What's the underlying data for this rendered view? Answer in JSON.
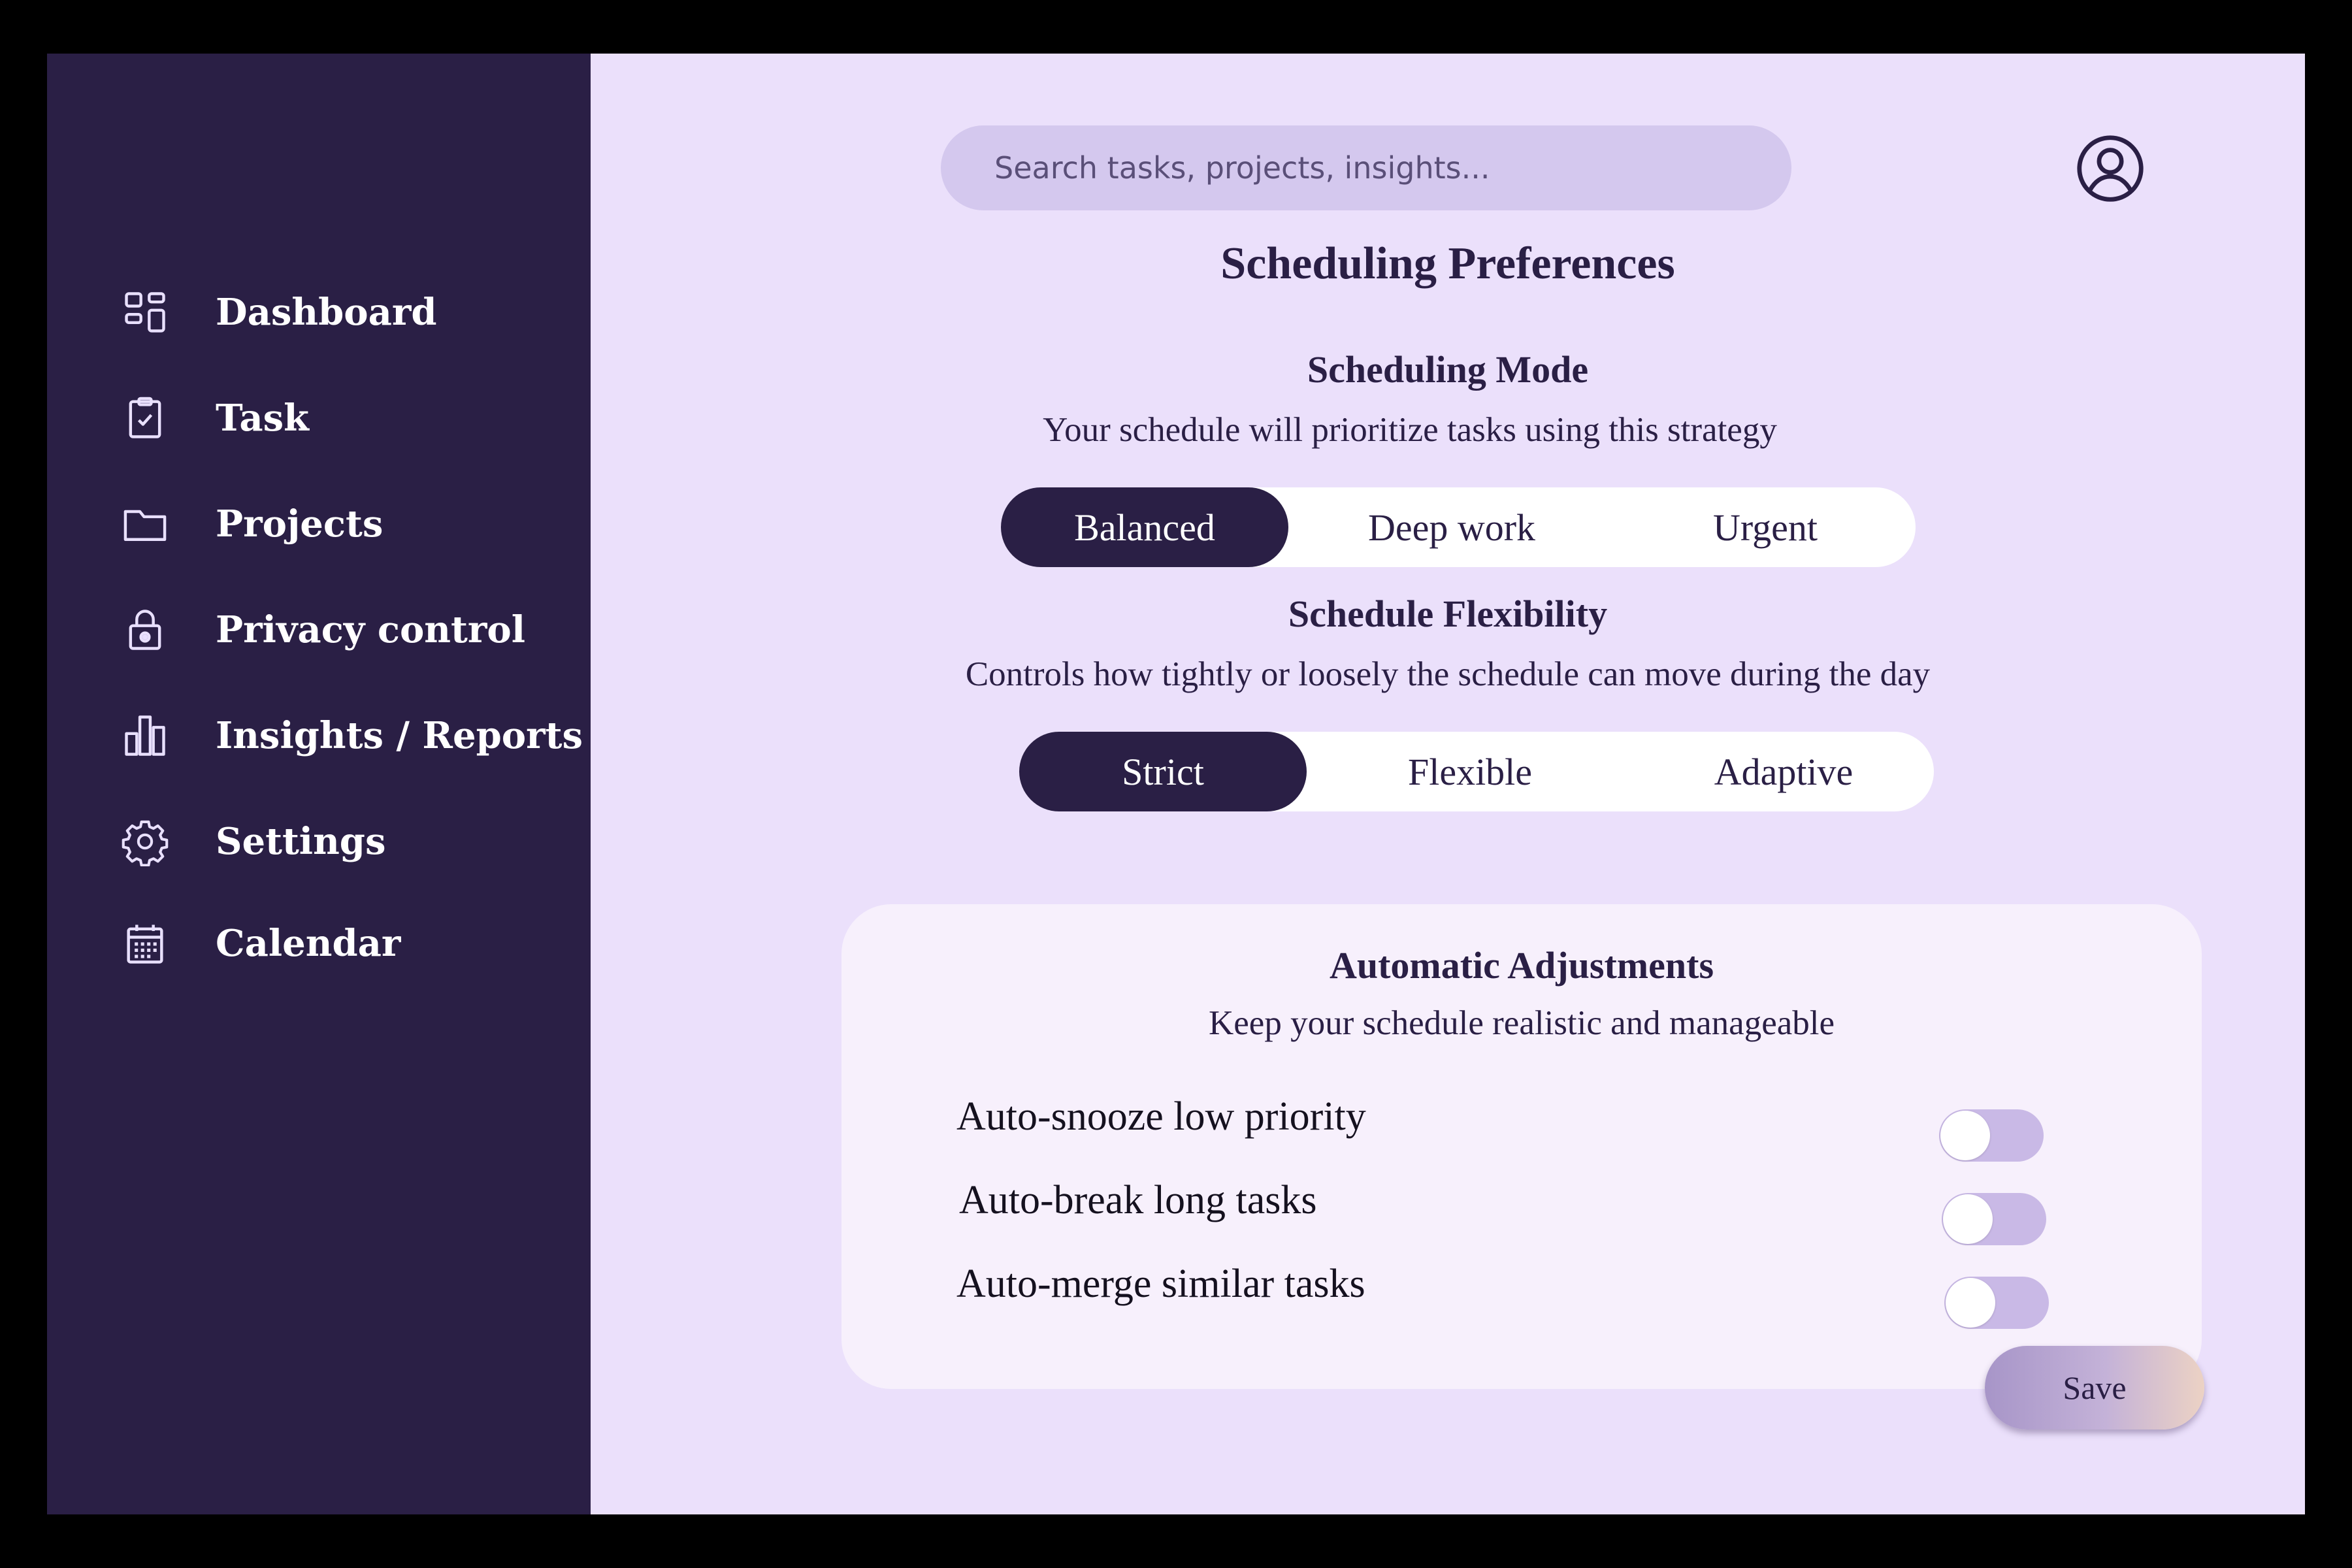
{
  "sidebar": {
    "items": [
      {
        "label": "Dashboard",
        "icon": "dashboard-icon"
      },
      {
        "label": "Task",
        "icon": "task-icon"
      },
      {
        "label": "Projects",
        "icon": "folder-icon"
      },
      {
        "label": "Privacy control",
        "icon": "lock-icon"
      },
      {
        "label": "Insights / Reports",
        "icon": "bar-chart-icon"
      },
      {
        "label": "Settings",
        "icon": "gear-icon"
      },
      {
        "label": "Calendar",
        "icon": "calendar-icon"
      }
    ]
  },
  "header": {
    "search_placeholder": "Search tasks, projects, insights...",
    "profile_icon": "user-circle-icon"
  },
  "main": {
    "title": "Scheduling Preferences",
    "mode": {
      "title": "Scheduling Mode",
      "subtitle": "Your schedule will prioritize tasks using this strategy",
      "options": [
        "Balanced",
        "Deep work",
        "Urgent"
      ],
      "selected": "Balanced"
    },
    "flexibility": {
      "title": "Schedule Flexibility",
      "subtitle": "Controls how tightly or loosely the schedule can move during the day",
      "options": [
        "Strict",
        "Flexible",
        "Adaptive"
      ],
      "selected": "Strict"
    },
    "auto": {
      "title": "Automatic Adjustments",
      "subtitle": "Keep your schedule realistic and manageable",
      "toggles": [
        {
          "label": "Auto-snooze low priority",
          "on": false
        },
        {
          "label": "Auto-break long tasks",
          "on": false
        },
        {
          "label": "Auto-merge similar tasks",
          "on": false
        }
      ]
    },
    "save_label": "Save"
  },
  "colors": {
    "sidebar_bg": "#2a1f45",
    "main_bg": "#ebe0fb",
    "accent": "#2a1f45",
    "card_bg": "#f7f0fc",
    "toggle_track": "#c9b9e6"
  }
}
